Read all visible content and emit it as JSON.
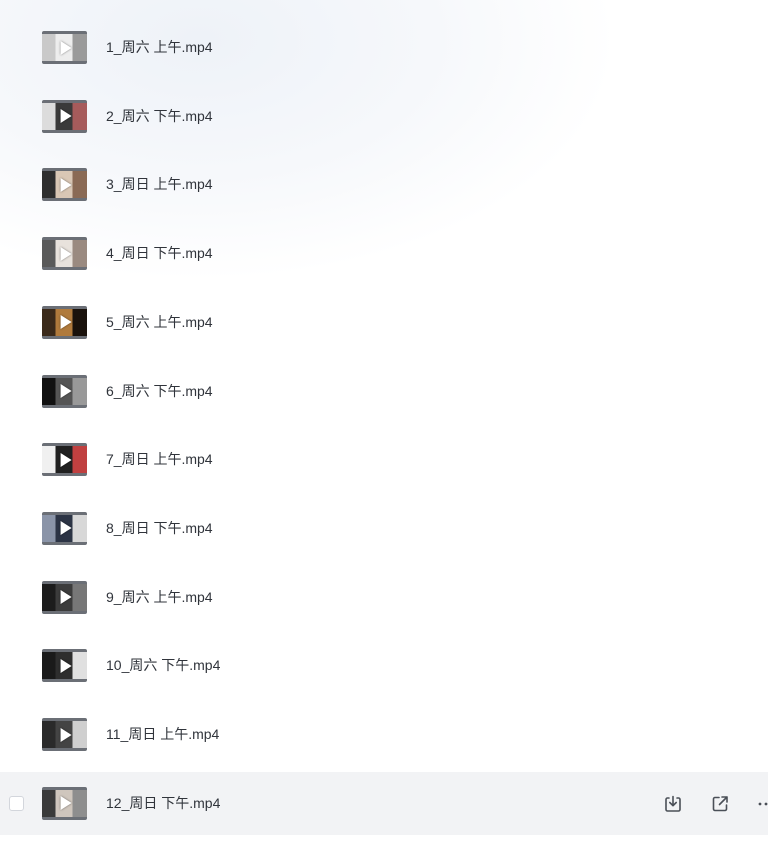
{
  "files": [
    {
      "name": "1_周六 上午.mp4",
      "thumb_colors": [
        "#c9c9c9",
        "#ededed",
        "#9a9a9a"
      ]
    },
    {
      "name": "2_周六 下午.mp4",
      "thumb_colors": [
        "#dcdcdc",
        "#3a3a3a",
        "#a65b5b"
      ]
    },
    {
      "name": "3_周日 上午.mp4",
      "thumb_colors": [
        "#2e2e2e",
        "#d9c7b5",
        "#8a6a55"
      ]
    },
    {
      "name": "4_周日 下午.mp4",
      "thumb_colors": [
        "#5a5a5a",
        "#e8e2dc",
        "#9a8a80"
      ]
    },
    {
      "name": "5_周六 上午.mp4",
      "thumb_colors": [
        "#3b2a1a",
        "#b07a3c",
        "#1a120c"
      ]
    },
    {
      "name": "6_周六 下午.mp4",
      "thumb_colors": [
        "#111111",
        "#555555",
        "#999999"
      ]
    },
    {
      "name": "7_周日 上午.mp4",
      "thumb_colors": [
        "#f0f0f0",
        "#202020",
        "#c04040"
      ]
    },
    {
      "name": "8_周日 下午.mp4",
      "thumb_colors": [
        "#8a94a8",
        "#2c3445",
        "#d8d8d8"
      ]
    },
    {
      "name": "9_周六 上午.mp4",
      "thumb_colors": [
        "#1c1c1c",
        "#3c3c3c",
        "#777777"
      ]
    },
    {
      "name": "10_周六 下午.mp4",
      "thumb_colors": [
        "#1a1a1a",
        "#2e2e2e",
        "#e0e0e0"
      ]
    },
    {
      "name": "11_周日 上午.mp4",
      "thumb_colors": [
        "#2a2a2a",
        "#444444",
        "#cfcfcf"
      ]
    },
    {
      "name": "12_周日 下午.mp4",
      "thumb_colors": [
        "#3a3a3a",
        "#cfc6bd",
        "#8e8e8e"
      ]
    }
  ],
  "hovered_index": 11,
  "actions": {
    "download_icon": "download-icon",
    "open_icon": "open-external-icon",
    "more_icon": "more-icon",
    "more_glyph": "···"
  },
  "colors": {
    "hover_row": "#f2f3f5",
    "text": "#30343b",
    "icon": "#4a4f57"
  }
}
